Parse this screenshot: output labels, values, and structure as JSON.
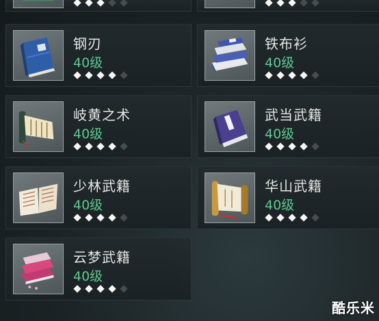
{
  "items": [
    {
      "name": "",
      "level": "",
      "stars_filled": 3,
      "stars_total": 5,
      "icon": "partial-item-icon"
    },
    {
      "name": "",
      "level": "",
      "stars_filled": 3,
      "stars_total": 5,
      "icon": "partial-item-icon"
    },
    {
      "name": "钢刃",
      "level": "40级",
      "stars_filled": 4,
      "stars_total": 5,
      "icon": "blue-book-icon"
    },
    {
      "name": "铁布衫",
      "level": "40级",
      "stars_filled": 4,
      "stars_total": 5,
      "icon": "stacked-books-icon"
    },
    {
      "name": "岐黄之术",
      "level": "40级",
      "stars_filled": 4,
      "stars_total": 5,
      "icon": "scroll-icon"
    },
    {
      "name": "武当武籍",
      "level": "40级",
      "stars_filled": 4,
      "stars_total": 5,
      "icon": "purple-book-icon"
    },
    {
      "name": "少林武籍",
      "level": "40级",
      "stars_filled": 4,
      "stars_total": 5,
      "icon": "open-book-icon"
    },
    {
      "name": "华山武籍",
      "level": "40级",
      "stars_filled": 4,
      "stars_total": 5,
      "icon": "golden-scroll-icon"
    },
    {
      "name": "云梦武籍",
      "level": "40级",
      "stars_filled": 4,
      "stars_total": 5,
      "icon": "pink-books-icon"
    }
  ],
  "colors": {
    "level": "#5fc98e",
    "name": "#e6e6e2",
    "star_on": "#f6f6f2",
    "star_off": "#454d50"
  },
  "watermark": "酷乐米"
}
